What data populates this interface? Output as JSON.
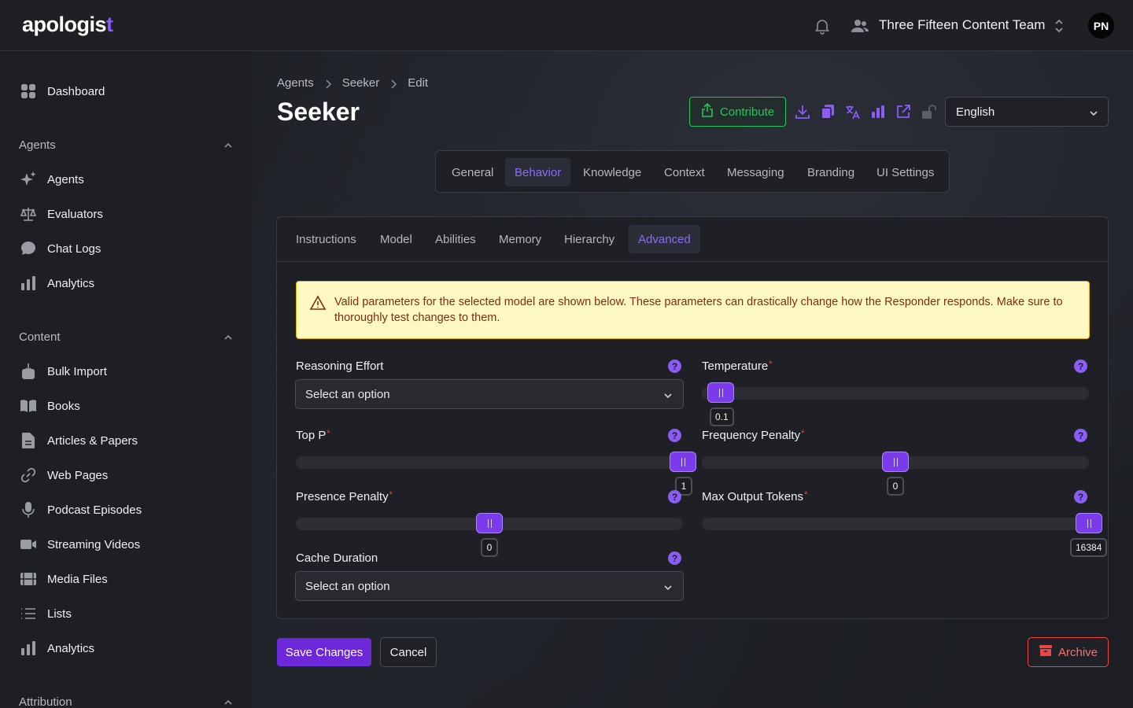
{
  "app": {
    "logo_text": "apologis",
    "logo_cross": "t"
  },
  "topbar": {
    "team_name": "Three Fifteen Content Team",
    "avatar_initials": "PN"
  },
  "sidebar": {
    "top_items": [
      {
        "label": "Dashboard",
        "icon": "grid-icon"
      }
    ],
    "sections": [
      {
        "title": "Agents",
        "items": [
          {
            "label": "Agents",
            "icon": "sparkles-icon"
          },
          {
            "label": "Evaluators",
            "icon": "scale-icon"
          },
          {
            "label": "Chat Logs",
            "icon": "chat-bubble-icon"
          },
          {
            "label": "Analytics",
            "icon": "bar-chart-icon"
          }
        ]
      },
      {
        "title": "Content",
        "items": [
          {
            "label": "Bulk Import",
            "icon": "bulk-import-icon"
          },
          {
            "label": "Books",
            "icon": "book-icon"
          },
          {
            "label": "Articles & Papers",
            "icon": "document-icon"
          },
          {
            "label": "Web Pages",
            "icon": "link-icon"
          },
          {
            "label": "Podcast Episodes",
            "icon": "microphone-icon"
          },
          {
            "label": "Streaming Videos",
            "icon": "video-camera-icon"
          },
          {
            "label": "Media Files",
            "icon": "film-icon"
          },
          {
            "label": "Lists",
            "icon": "list-icon"
          },
          {
            "label": "Analytics",
            "icon": "bar-chart-icon"
          }
        ]
      },
      {
        "title": "Attribution",
        "items": []
      }
    ]
  },
  "breadcrumb": [
    "Agents",
    "Seeker",
    "Edit"
  ],
  "page_title": "Seeker",
  "toolbar": {
    "contribute_label": "Contribute",
    "language": "English"
  },
  "main_tabs": [
    "General",
    "Behavior",
    "Knowledge",
    "Context",
    "Messaging",
    "Branding",
    "UI Settings"
  ],
  "main_tab_active": "Behavior",
  "sub_tabs": [
    "Instructions",
    "Model",
    "Abilities",
    "Memory",
    "Hierarchy",
    "Advanced"
  ],
  "sub_tab_active": "Advanced",
  "warning": "Valid parameters for the selected model are shown below. These parameters can drastically change how the Responder responds. Make sure to thoroughly test changes to them.",
  "fields": {
    "reasoning_effort": {
      "label": "Reasoning Effort",
      "value": "Select an option"
    },
    "temperature": {
      "label": "Temperature",
      "value": "0.1",
      "fraction": 0.05
    },
    "top_p": {
      "label": "Top P",
      "value": "1",
      "fraction": 1.0
    },
    "frequency_penalty": {
      "label": "Frequency Penalty",
      "value": "0",
      "fraction": 0.5
    },
    "presence_penalty": {
      "label": "Presence Penalty",
      "value": "0",
      "fraction": 0.5
    },
    "max_output_tokens": {
      "label": "Max Output Tokens",
      "value": "16384",
      "fraction": 1.0
    },
    "cache_duration": {
      "label": "Cache Duration",
      "value": "Select an option"
    }
  },
  "help_glyph": "?",
  "actions": {
    "save": "Save Changes",
    "cancel": "Cancel",
    "archive": "Archive"
  },
  "colors": {
    "accent": "#8b5cf6",
    "success": "#22c55e",
    "danger": "#ef4444",
    "warning_bg": "#fef9c3"
  }
}
